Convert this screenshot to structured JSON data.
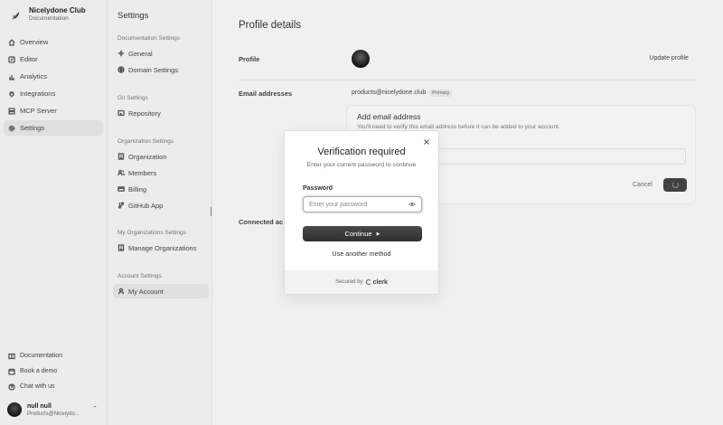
{
  "app": {
    "name": "Nicelydone Club",
    "subtitle": "Documentation"
  },
  "sidebar": {
    "items": [
      {
        "label": "Overview",
        "icon": "home-icon"
      },
      {
        "label": "Editor",
        "icon": "edit-icon"
      },
      {
        "label": "Analytics",
        "icon": "chart-icon"
      },
      {
        "label": "Integrations",
        "icon": "plug-icon"
      },
      {
        "label": "MCP Server",
        "icon": "server-icon"
      },
      {
        "label": "Settings",
        "icon": "gear-icon",
        "active": true
      }
    ],
    "bottom": [
      {
        "label": "Documentation",
        "icon": "book-icon"
      },
      {
        "label": "Book a demo",
        "icon": "calendar-icon"
      },
      {
        "label": "Chat with us",
        "icon": "help-icon"
      }
    ],
    "user": {
      "name": "null null",
      "email": "Products@Nicelydo..."
    }
  },
  "settings": {
    "title": "Settings",
    "groups": [
      {
        "title": "Documentation Settings",
        "items": [
          "General",
          "Domain Settings"
        ]
      },
      {
        "title": "Git Settings",
        "items": [
          "Repository"
        ]
      },
      {
        "title": "Organization Settings",
        "items": [
          "Organization",
          "Members",
          "Billing",
          "GitHub App"
        ]
      },
      {
        "title": "My Organizations Settings",
        "items": [
          "Manage Organizations"
        ]
      },
      {
        "title": "Account Settings",
        "items": [
          "My Account"
        ]
      }
    ]
  },
  "main": {
    "title": "Profile details",
    "profile_label": "Profile",
    "update_profile": "Update profile",
    "email_label": "Email addresses",
    "email": "products@nicelydone.club",
    "primary_badge": "Primary",
    "add_email_title": "Add email address",
    "add_email_desc": "You'll need to verify this email address before it can be added to your account.",
    "cancel": "Cancel",
    "connected_label": "Connected ac"
  },
  "modal": {
    "title": "Verification required",
    "subtitle": "Enter your current password to continue",
    "password_label": "Password",
    "password_placeholder": "Enter your password",
    "continue_label": "Continue",
    "another_method": "Use another method",
    "secured_by": "Secured by",
    "brand": "clerk"
  },
  "colors": {
    "primary_button": "#333333",
    "background": "#f7f7f7",
    "sidebar": "#f3f3f3"
  }
}
